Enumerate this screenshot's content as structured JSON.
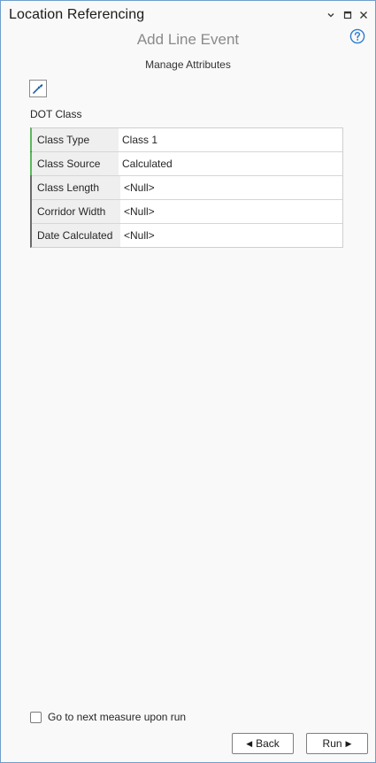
{
  "pane": {
    "title": "Location Referencing",
    "controls": [
      "chevron-down-icon",
      "maximize-icon",
      "close-icon"
    ]
  },
  "header": {
    "subtitle": "Add Line Event",
    "help_icon": "help-circle-icon"
  },
  "section": {
    "title": "Manage Attributes"
  },
  "picker": {
    "icon": "eyedropper-icon"
  },
  "group": {
    "label": "DOT Class"
  },
  "attributes": [
    {
      "name": "Class Type",
      "value": "Class 1",
      "required": true
    },
    {
      "name": "Class Source",
      "value": "Calculated",
      "required": true
    },
    {
      "name": "Class Length",
      "value": "<Null>",
      "required": false
    },
    {
      "name": "Corridor Width",
      "value": "<Null>",
      "required": false
    },
    {
      "name": "Date Calculated",
      "value": "<Null>",
      "required": false
    }
  ],
  "options": {
    "next_measure_label": "Go to next measure upon run",
    "next_measure_checked": false
  },
  "footer": {
    "back_label": "Back",
    "run_label": "Run"
  },
  "colors": {
    "accent": "#2f7dd1",
    "required_marker": "#5cb85c",
    "pane_border": "#6f9ec9"
  }
}
